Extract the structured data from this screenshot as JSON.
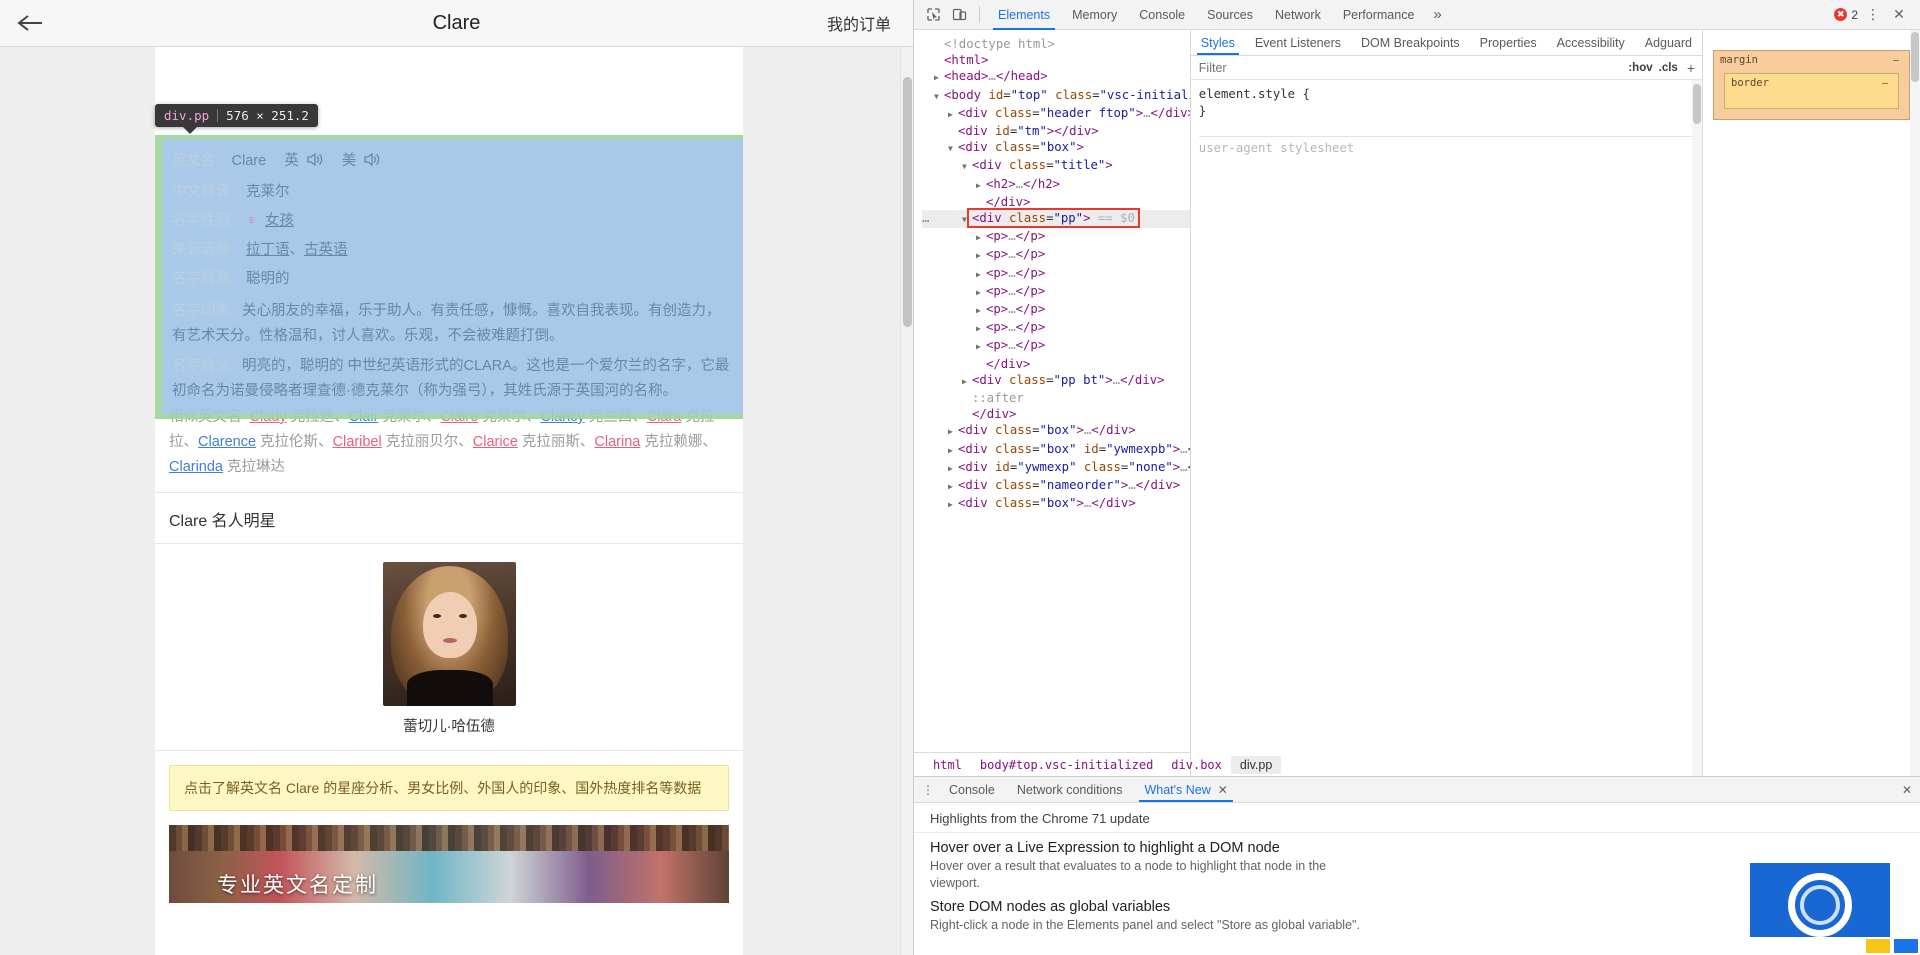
{
  "page": {
    "header": {
      "title": "Clare",
      "back_icon": "back-arrow-icon",
      "my_orders": "我的订单"
    },
    "inspector_tooltip": {
      "tag": "div.pp",
      "dimensions": "576 × 251.2"
    },
    "name_info": {
      "rows": [
        {
          "label": "英文名",
          "value": "Clare",
          "uk": "英",
          "us": "美"
        },
        {
          "label": "中文音译",
          "value": "克莱尔"
        },
        {
          "label": "名字性别",
          "value": "女孩",
          "gender_symbol": "♀"
        },
        {
          "label": "来源语种",
          "value_parts": [
            "拉丁语",
            "、",
            "古英语"
          ]
        },
        {
          "label": "名字寓意",
          "value": "聪明的"
        },
        {
          "label": "名字印象",
          "value": "关心朋友的幸福，乐于助人。有责任感，慷慨。喜欢自我表现。有创造力，有艺术天分。性格温和，讨人喜欢。乐观，不会被难题打倒。"
        },
        {
          "label": "名字含义",
          "value": "明亮的，聪明的 中世纪英语形式的CLARA。这也是一个爱尔兰的名字，它最初命名为诺曼侵略者理查德·德克莱尔（称为强弓），其姓氏源于英国河的名称。"
        }
      ]
    },
    "similar_names": {
      "label": "相似英文名",
      "items": [
        {
          "en": "Clady",
          "cn": "克拉迪",
          "color": "pink"
        },
        {
          "en": "Clair",
          "cn": "克莱尔",
          "color": "blue"
        },
        {
          "en": "Claire",
          "cn": "克莱尔",
          "color": "pink"
        },
        {
          "en": "Clancy",
          "cn": "克兰西",
          "color": "blue"
        },
        {
          "en": "Clara",
          "cn": "克拉拉",
          "color": "pink"
        },
        {
          "en": "Clarence",
          "cn": "克拉伦斯",
          "color": "blue"
        },
        {
          "en": "Claribel",
          "cn": "克拉丽贝尔",
          "color": "pink"
        },
        {
          "en": "Clarice",
          "cn": "克拉丽斯",
          "color": "pink"
        },
        {
          "en": "Clarina",
          "cn": "克拉赖娜",
          "color": "pink"
        },
        {
          "en": "Clarinda",
          "cn": "克拉琳达",
          "color": "blue"
        }
      ],
      "separator": "、"
    },
    "celebrity": {
      "section_title": "Clare 名人明星",
      "photo": "celebrity-photo",
      "name": "蕾切儿·哈伍德"
    },
    "notice": "点击了解英文名 Clare 的星座分析、男女比例、外国人的印象、国外热度排名等数据",
    "banner": {
      "text": "专业英文名定制"
    }
  },
  "devtools": {
    "toolbar": {
      "inspect_icon": "inspect-element-icon",
      "device_icon": "device-toolbar-icon",
      "tabs": [
        {
          "label": "Elements",
          "active": true
        },
        {
          "label": "Memory",
          "active": false
        },
        {
          "label": "Console",
          "active": false
        },
        {
          "label": "Sources",
          "active": false
        },
        {
          "label": "Network",
          "active": false
        },
        {
          "label": "Performance",
          "active": false
        }
      ],
      "more_icon": "chevron-double-right-icon",
      "error_count": "2",
      "kebab_icon": "vertical-dots-icon",
      "close_icon": "close-icon"
    },
    "dom_tree": [
      {
        "indent": 0,
        "twisty": "none",
        "html": "<span class=\"cm\">&lt;!doctype html&gt;</span>"
      },
      {
        "indent": 0,
        "twisty": "none",
        "html": "<span class=\"pk\">&lt;html&gt;</span>"
      },
      {
        "indent": 0,
        "twisty": "right",
        "html": "<span class=\"pk\">&lt;head&gt;</span><span class=\"el\">…</span><span class=\"pk\">&lt;/head&gt;</span>"
      },
      {
        "indent": 0,
        "twisty": "down",
        "html": "<span class=\"pk\">&lt;body</span> <span class=\"at\">id</span>=<span class=\"av\">\"top\"</span> <span class=\"at\">class</span>=<span class=\"av\">\"vsc-initialized\"</span><span class=\"pk\">&gt;</span>"
      },
      {
        "indent": 1,
        "twisty": "right",
        "html": "<span class=\"pk\">&lt;div</span> <span class=\"at\">class</span>=<span class=\"av\">\"header ftop\"</span><span class=\"pk\">&gt;</span><span class=\"el\">…</span><span class=\"pk\">&lt;/div&gt;</span>"
      },
      {
        "indent": 1,
        "twisty": "none",
        "html": "<span class=\"pk\">&lt;div</span> <span class=\"at\">id</span>=<span class=\"av\">\"tm\"</span><span class=\"pk\">&gt;&lt;/div&gt;</span>"
      },
      {
        "indent": 1,
        "twisty": "down",
        "html": "<span class=\"pk\">&lt;div</span> <span class=\"at\">class</span>=<span class=\"av\">\"box\"</span><span class=\"pk\">&gt;</span>"
      },
      {
        "indent": 2,
        "twisty": "down",
        "html": "<span class=\"pk\">&lt;div</span> <span class=\"at\">class</span>=<span class=\"av\">\"title\"</span><span class=\"pk\">&gt;</span>"
      },
      {
        "indent": 3,
        "twisty": "right",
        "html": "<span class=\"pk\">&lt;h2&gt;</span><span class=\"el\">…</span><span class=\"pk\">&lt;/h2&gt;</span>"
      },
      {
        "indent": 3,
        "twisty": "none",
        "html": "<span class=\"pk\">&lt;/div&gt;</span>"
      },
      {
        "indent": 2,
        "twisty": "down",
        "selected": true,
        "html": "<span class=\"pk\">&lt;div</span> <span class=\"at\">class</span>=<span class=\"av\">\"pp\"</span><span class=\"pk\">&gt;</span> <span class=\"eqdollar\">== $0</span>"
      },
      {
        "indent": 3,
        "twisty": "right",
        "html": "<span class=\"pk\">&lt;p&gt;</span><span class=\"el\">…</span><span class=\"pk\">&lt;/p&gt;</span>"
      },
      {
        "indent": 3,
        "twisty": "right",
        "html": "<span class=\"pk\">&lt;p&gt;</span><span class=\"el\">…</span><span class=\"pk\">&lt;/p&gt;</span>"
      },
      {
        "indent": 3,
        "twisty": "right",
        "html": "<span class=\"pk\">&lt;p&gt;</span><span class=\"el\">…</span><span class=\"pk\">&lt;/p&gt;</span>"
      },
      {
        "indent": 3,
        "twisty": "right",
        "html": "<span class=\"pk\">&lt;p&gt;</span><span class=\"el\">…</span><span class=\"pk\">&lt;/p&gt;</span>"
      },
      {
        "indent": 3,
        "twisty": "right",
        "html": "<span class=\"pk\">&lt;p&gt;</span><span class=\"el\">…</span><span class=\"pk\">&lt;/p&gt;</span>"
      },
      {
        "indent": 3,
        "twisty": "right",
        "html": "<span class=\"pk\">&lt;p&gt;</span><span class=\"el\">…</span><span class=\"pk\">&lt;/p&gt;</span>"
      },
      {
        "indent": 3,
        "twisty": "right",
        "html": "<span class=\"pk\">&lt;p&gt;</span><span class=\"el\">…</span><span class=\"pk\">&lt;/p&gt;</span>"
      },
      {
        "indent": 3,
        "twisty": "none",
        "html": "<span class=\"pk\">&lt;/div&gt;</span>"
      },
      {
        "indent": 2,
        "twisty": "right",
        "html": "<span class=\"pk\">&lt;div</span> <span class=\"at\">class</span>=<span class=\"av\">\"pp bt\"</span><span class=\"pk\">&gt;</span><span class=\"el\">…</span><span class=\"pk\">&lt;/div&gt;</span>"
      },
      {
        "indent": 2,
        "twisty": "none",
        "html": "<span class=\"gy\">::after</span>"
      },
      {
        "indent": 2,
        "twisty": "none",
        "html": "<span class=\"pk\">&lt;/div&gt;</span>"
      },
      {
        "indent": 1,
        "twisty": "right",
        "html": "<span class=\"pk\">&lt;div</span> <span class=\"at\">class</span>=<span class=\"av\">\"box\"</span><span class=\"pk\">&gt;</span><span class=\"el\">…</span><span class=\"pk\">&lt;/div&gt;</span>"
      },
      {
        "indent": 1,
        "twisty": "right",
        "html": "<span class=\"pk\">&lt;div</span> <span class=\"at\">class</span>=<span class=\"av\">\"box\"</span> <span class=\"at\">id</span>=<span class=\"av\">\"ywmexpb\"</span><span class=\"pk\">&gt;</span><span class=\"el\">…</span><span class=\"pk\">&lt;/div&gt;</span>"
      },
      {
        "indent": 1,
        "twisty": "right",
        "html": "<span class=\"pk\">&lt;div</span> <span class=\"at\">id</span>=<span class=\"av\">\"ywmexp\"</span> <span class=\"at\">class</span>=<span class=\"av\">\"none\"</span><span class=\"pk\">&gt;</span><span class=\"el\">…</span><span class=\"pk\">&lt;/div&gt;</span>"
      },
      {
        "indent": 1,
        "twisty": "right",
        "html": "<span class=\"pk\">&lt;div</span> <span class=\"at\">class</span>=<span class=\"av\">\"nameorder\"</span><span class=\"pk\">&gt;</span><span class=\"el\">…</span><span class=\"pk\">&lt;/div&gt;</span>"
      },
      {
        "indent": 1,
        "twisty": "right",
        "html": "<span class=\"pk\">&lt;div</span> <span class=\"at\">class</span>=<span class=\"av\">\"box\"</span><span class=\"pk\">&gt;</span><span class=\"el\">…</span><span class=\"pk\">&lt;/div&gt;</span>"
      }
    ],
    "breadcrumbs": [
      {
        "label": "html",
        "active": false
      },
      {
        "label": "body#top.vsc-initialized",
        "active": false
      },
      {
        "label": "div.box",
        "active": false
      },
      {
        "label": "div.pp",
        "active": true
      }
    ],
    "styles": {
      "tabs": [
        {
          "label": "Styles",
          "active": true
        },
        {
          "label": "Event Listeners",
          "active": false
        },
        {
          "label": "DOM Breakpoints",
          "active": false
        },
        {
          "label": "Properties",
          "active": false
        },
        {
          "label": "Accessibility",
          "active": false
        },
        {
          "label": "Adguard",
          "active": false
        }
      ],
      "filter_placeholder": "Filter",
      "hov_label": ":hov",
      "cls_label": ".cls",
      "plus_icon": "add-style-rule-icon",
      "element_style": "element.style {",
      "element_style_close": "}",
      "ghost_rule": "user-agent stylesheet"
    },
    "metrics": {
      "margin_label": "margin",
      "margin_value": "–",
      "border_label": "border",
      "border_value": "–"
    },
    "drawer": {
      "kebab_icon": "vertical-dots-icon",
      "tabs": [
        {
          "label": "Console",
          "active": false,
          "closable": false
        },
        {
          "label": "Network conditions",
          "active": false,
          "closable": false
        },
        {
          "label": "What's New",
          "active": true,
          "closable": true
        }
      ],
      "close_icon": "close-icon",
      "whats_new": {
        "heading": "Highlights from the Chrome 71 update",
        "items": [
          {
            "title": "Hover over a Live Expression to highlight a DOM node",
            "desc": "Hover over a result that evaluates to a node to highlight that node in the viewport."
          },
          {
            "title": "Store DOM nodes as global variables",
            "desc": "Right-click a node in the Elements panel and select \"Store as global variable\"."
          }
        ]
      }
    }
  }
}
